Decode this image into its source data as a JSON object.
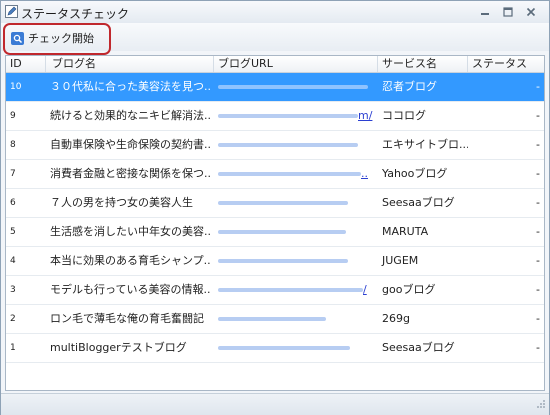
{
  "window": {
    "title": "ステータスチェック"
  },
  "toolbar": {
    "check_label": "チェック開始"
  },
  "columns": [
    "ID",
    "ブログ名",
    "ブログURL",
    "サービス名",
    "ステータス"
  ],
  "rows": [
    {
      "id": "10",
      "name": "３０代私に合った美容法を見つ...",
      "url_tail": "",
      "service": "忍者ブログ",
      "status": "-"
    },
    {
      "id": "9",
      "name": "続けると効果的なニキビ解消法...",
      "url_tail": "m/",
      "service": "ココログ",
      "status": "-"
    },
    {
      "id": "8",
      "name": "自動車保険や生命保険の契約書...",
      "url_tail": "",
      "service": "エキサイトブロ...",
      "status": "-"
    },
    {
      "id": "7",
      "name": "消費者金融と密接な関係を保つ...",
      "url_tail": "..",
      "service": "Yahooブログ",
      "status": "-"
    },
    {
      "id": "6",
      "name": "７人の男を持つ女の美容人生",
      "url_tail": "",
      "service": "Seesaaブログ",
      "status": "-"
    },
    {
      "id": "5",
      "name": "生活感を消したい中年女の美容...",
      "url_tail": "",
      "service": "MARUTA",
      "status": "-"
    },
    {
      "id": "4",
      "name": "本当に効果のある育毛シャンプ...",
      "url_tail": "",
      "service": "JUGEM",
      "status": "-"
    },
    {
      "id": "3",
      "name": "モデルも行っている美容の情報...",
      "url_tail": "/",
      "service": "gooブログ",
      "status": "-"
    },
    {
      "id": "2",
      "name": "ロン毛で薄毛な俺の育毛奮闘記",
      "url_tail": "",
      "service": "269g",
      "status": "-"
    },
    {
      "id": "1",
      "name": "multiBloggerテストブログ",
      "url_tail": "",
      "service": "Seesaaブログ",
      "status": "-"
    }
  ],
  "selected_row_index": 0,
  "colors": {
    "selection": "#3399ff",
    "highlight_ring": "#c0282d",
    "link": "#2b3fd1"
  }
}
